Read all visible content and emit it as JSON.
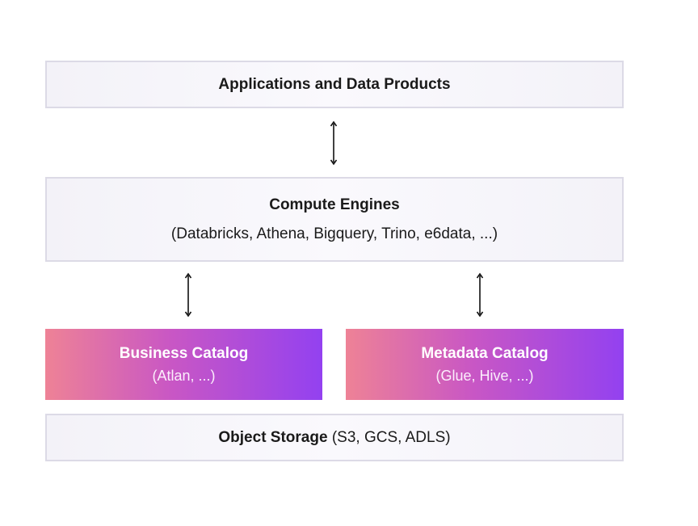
{
  "layers": {
    "applications": {
      "title": "Applications and Data Products"
    },
    "compute": {
      "title": "Compute Engines",
      "subtitle": "(Databricks, Athena, Bigquery, Trino, e6data, ...)"
    },
    "business_catalog": {
      "title": "Business Catalog",
      "subtitle": "(Atlan, ...)"
    },
    "metadata_catalog": {
      "title": "Metadata Catalog",
      "subtitle": "(Glue, Hive, ...)"
    },
    "object_storage": {
      "title": "Object Storage",
      "detail": "(S3, GCS, ADLS)"
    }
  },
  "connectors": [
    {
      "from": "applications",
      "to": "compute",
      "type": "bidirectional"
    },
    {
      "from": "compute",
      "to": "business_catalog",
      "type": "bidirectional"
    },
    {
      "from": "compute",
      "to": "metadata_catalog",
      "type": "bidirectional"
    }
  ],
  "colors": {
    "light_box_fill": "#f6f5fa",
    "light_box_border": "#dcdae6",
    "gradient_start": "#ee8296",
    "gradient_end": "#9341f0",
    "text_dark": "#1a1a1a",
    "text_light": "#ffffff"
  }
}
